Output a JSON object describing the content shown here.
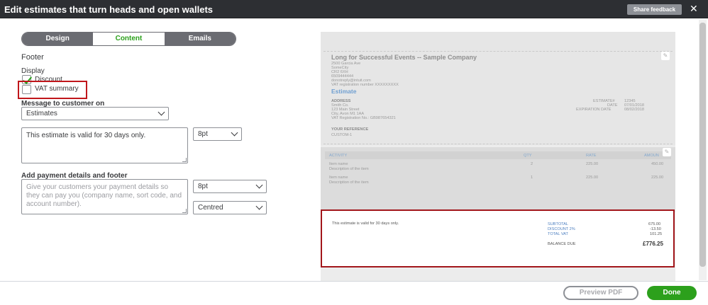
{
  "window": {
    "title": "Edit estimates that turn heads and open wallets",
    "share_feedback": "Share feedback",
    "close_glyph": "✕"
  },
  "tabs": [
    {
      "label": "Design",
      "active": false
    },
    {
      "label": "Content",
      "active": true
    },
    {
      "label": "Emails",
      "active": false
    }
  ],
  "form": {
    "section_title": "Footer",
    "display_label": "Display",
    "discount": {
      "label": "Discount",
      "checked": true
    },
    "vat_summary": {
      "label": "VAT summary",
      "checked": false
    },
    "message_label": "Message to customer on",
    "message_select": "Estimates",
    "message_text": "This estimate is valid for 30 days only.",
    "message_font_size": "8pt",
    "payment_label": "Add payment details and footer",
    "payment_placeholder": "Give your customers your payment details so they can pay you (company name, sort code, and account number).",
    "payment_font_size": "8pt",
    "payment_alignment": "Centred"
  },
  "preview": {
    "company_name": "Long for Successful Events -- Sample Company",
    "address_lines": [
      "2500 Garcia Ave",
      "SomeCity",
      "CR2 6XH",
      "6509444444",
      "donotreply@intuit.com",
      "VAT registration number XXXXXXXXX"
    ],
    "doc_title": "Estimate",
    "address_head": "ADDRESS",
    "customer_lines": [
      "Smith Co.",
      "123 Main Street",
      "City, Avon M1 1AA",
      "VAT Registration No.: GB987654321"
    ],
    "meta_labels": [
      "ESTIMATE#",
      "DATE",
      "EXPIRATION DATE"
    ],
    "meta_values": [
      "12345",
      "07/01/2018",
      "08/02/2018"
    ],
    "reference_head": "YOUR REFERENCE",
    "reference_value": "CUSTOM-1",
    "table_headers": [
      "ACTIVITY",
      "QTY",
      "RATE",
      "AMOUN"
    ],
    "rows": [
      {
        "name": "Item name",
        "desc": "Description of the item",
        "qty": "2",
        "rate": "225.00",
        "amount": "450.00"
      },
      {
        "name": "Item name",
        "desc": "Description of the item",
        "qty": "1",
        "rate": "225.00",
        "amount": "225.00"
      }
    ],
    "footer_message": "This estimate is valid for 30 days only.",
    "subtotal_label": "SUBTOTAL",
    "subtotal_value": "675.00",
    "discount_label": "DISCOUNT 2%",
    "discount_value": "-13.50",
    "vat_label": "TOTAL VAT",
    "vat_value": "101.25",
    "balance_label": "BALANCE DUE",
    "balance_value": "£776.25",
    "pencil_glyph": "✎"
  },
  "actions": {
    "preview_pdf": "Preview PDF",
    "done": "Done"
  },
  "colors": {
    "brand_green": "#2ca01c",
    "titlebar": "#2d2f33",
    "highlight_red": "#c0161b"
  }
}
